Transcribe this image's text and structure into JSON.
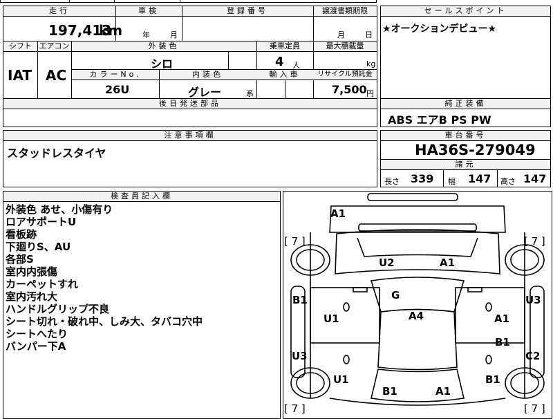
{
  "top_row": {
    "fragment": "□"
  },
  "headers": {
    "mileage": "走行",
    "inspection": "車検",
    "registration_no": "登録番号",
    "transfer_deadline": "譲渡書類期限",
    "sales_point": "セールスポイント",
    "shift": "シフト",
    "aircon": "エアコン",
    "exterior_color": "外装色",
    "capacity": "乗車定員",
    "max_load": "最大積載量",
    "color_no": "カラーNo.",
    "interior_color": "内装色",
    "import_car": "輸入車",
    "recycle_deposit": "リサイクル預託金",
    "later_parts": "後日発送部品",
    "genuine_equipment": "純正装備",
    "notes": "注意事項欄",
    "chassis_no": "車台番号",
    "dimensions": "諸元",
    "inspector_notes": "検査員記入欄"
  },
  "values": {
    "mileage": "197,413",
    "mileage_unit": "km",
    "inspection_year_unit": "年",
    "inspection_month_unit": "月",
    "transfer_month_unit": "月",
    "transfer_day_unit": "日",
    "sales_point": "★オークションデビュー★",
    "shift": "IAT",
    "aircon": "AC",
    "exterior_color": "シロ",
    "capacity": "4",
    "capacity_unit": "人",
    "max_load_unit": "kg",
    "color_no": "26U",
    "interior_color": "グレー",
    "interior_suffix": "系",
    "recycle_deposit": "7,500",
    "recycle_unit": "円",
    "genuine_equipment": "ABS エアB PS PW",
    "notes": "スタッドレスタイヤ",
    "chassis_no": "HA36S-279049",
    "length_label": "長さ",
    "length": "339",
    "width_label": "幅",
    "width": "147",
    "height_label": "高さ",
    "height": "147"
  },
  "inspector_notes": [
    "外装色 あせ、小傷有り",
    "ロアサポートU",
    "看板跡",
    "下廻りS、AU",
    "各部S",
    "室内内張傷",
    "カーペットすれ",
    "室内汚れ大",
    "ハンドルグリップ不良",
    "シート切れ・破れ中、しみ大、タバコ穴中",
    "シートへたり",
    "バンパー下A"
  ],
  "diagram": {
    "tire_fl": "[ 7 ]",
    "tire_fr": "[ 7 ]",
    "tire_rl": "[ 7 ]",
    "tire_rr": "[ 7 ]",
    "front_bumper": "A1",
    "hood_left": "U2",
    "hood_right": "A1",
    "windshield": "G",
    "roof": "A4",
    "left_fender": "B1",
    "right_fender": "U3",
    "left_front_door": "U1",
    "right_front_door": "A1",
    "right_rear_door": "B1",
    "left_rear_quarter": "U3",
    "right_rear_quarter": "C2",
    "left_rear_door_lower": "U1",
    "right_rear_door_lower": "B1",
    "rear_left": "B1",
    "rear_right": "A1"
  }
}
